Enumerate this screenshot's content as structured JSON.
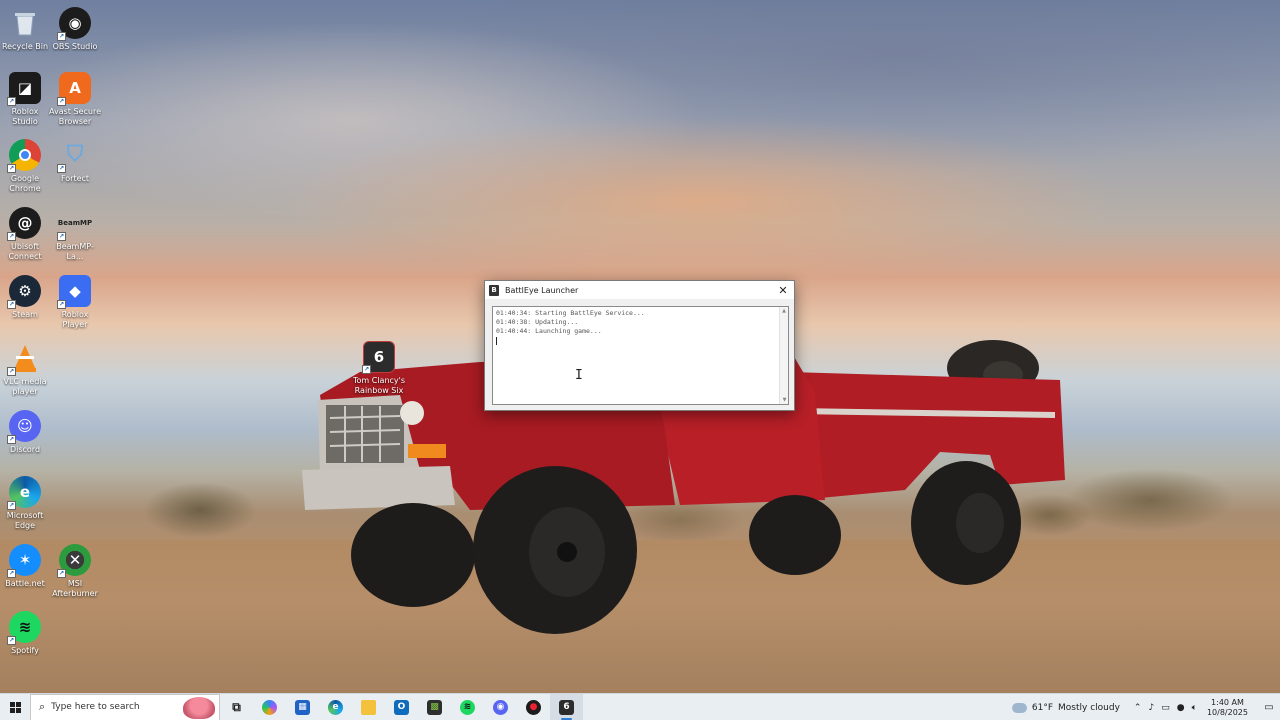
{
  "desktop_icons": [
    {
      "label": "Recycle Bin",
      "icon": "recycle-bin-icon"
    },
    {
      "label": "OBS Studio",
      "icon": "obs-icon"
    },
    {
      "label": "Roblox Studio",
      "icon": "roblox-studio-icon"
    },
    {
      "label": "Avast Secure Browser",
      "icon": "avast-icon"
    },
    {
      "label": "Google Chrome",
      "icon": "chrome-icon"
    },
    {
      "label": "Fortect",
      "icon": "fortect-icon"
    },
    {
      "label": "Ubisoft Connect",
      "icon": "ubisoft-icon"
    },
    {
      "label": "BeamMP-La...",
      "icon": "beammp-icon"
    },
    {
      "label": "Steam",
      "icon": "steam-icon"
    },
    {
      "label": "Roblox Player",
      "icon": "roblox-player-icon"
    },
    {
      "label": "VLC media player",
      "icon": "vlc-icon"
    },
    {
      "label": "Discord",
      "icon": "discord-icon"
    },
    {
      "label": "Microsoft Edge",
      "icon": "edge-icon"
    },
    {
      "label": "Battle.net",
      "icon": "battlenet-icon"
    },
    {
      "label": "MSI Afterburner",
      "icon": "msi-afterburner-icon"
    },
    {
      "label": "Spotify",
      "icon": "spotify-icon"
    },
    {
      "label": "Tom Clancy's Rainbow Six",
      "icon": "rainbow-six-icon"
    }
  ],
  "battleye": {
    "title": "BattlEye Launcher",
    "close": "✕",
    "log": [
      "01:40:34: Starting BattlEye Service...",
      "01:40:38: Updating...",
      "01:40:44: Launching game..."
    ]
  },
  "taskbar": {
    "search_placeholder": "Type here to search",
    "apps": [
      {
        "name": "task-view",
        "icon": "task-view-icon"
      },
      {
        "name": "copilot",
        "icon": "copilot-icon"
      },
      {
        "name": "microsoft-store",
        "icon": "store-icon"
      },
      {
        "name": "edge",
        "icon": "edge-icon"
      },
      {
        "name": "file-explorer",
        "icon": "folder-icon"
      },
      {
        "name": "outlook",
        "icon": "outlook-icon"
      },
      {
        "name": "minecraft",
        "icon": "minecraft-icon"
      },
      {
        "name": "spotify",
        "icon": "spotify-icon"
      },
      {
        "name": "obs",
        "icon": "obs-icon"
      },
      {
        "name": "battleye",
        "icon": "battleye-icon"
      },
      {
        "name": "rainbow-six",
        "icon": "rainbow-six-icon"
      }
    ],
    "weather_temp": "61°F",
    "weather_desc": "Mostly cloudy",
    "time": "1:40 AM",
    "date": "10/8/2025"
  }
}
